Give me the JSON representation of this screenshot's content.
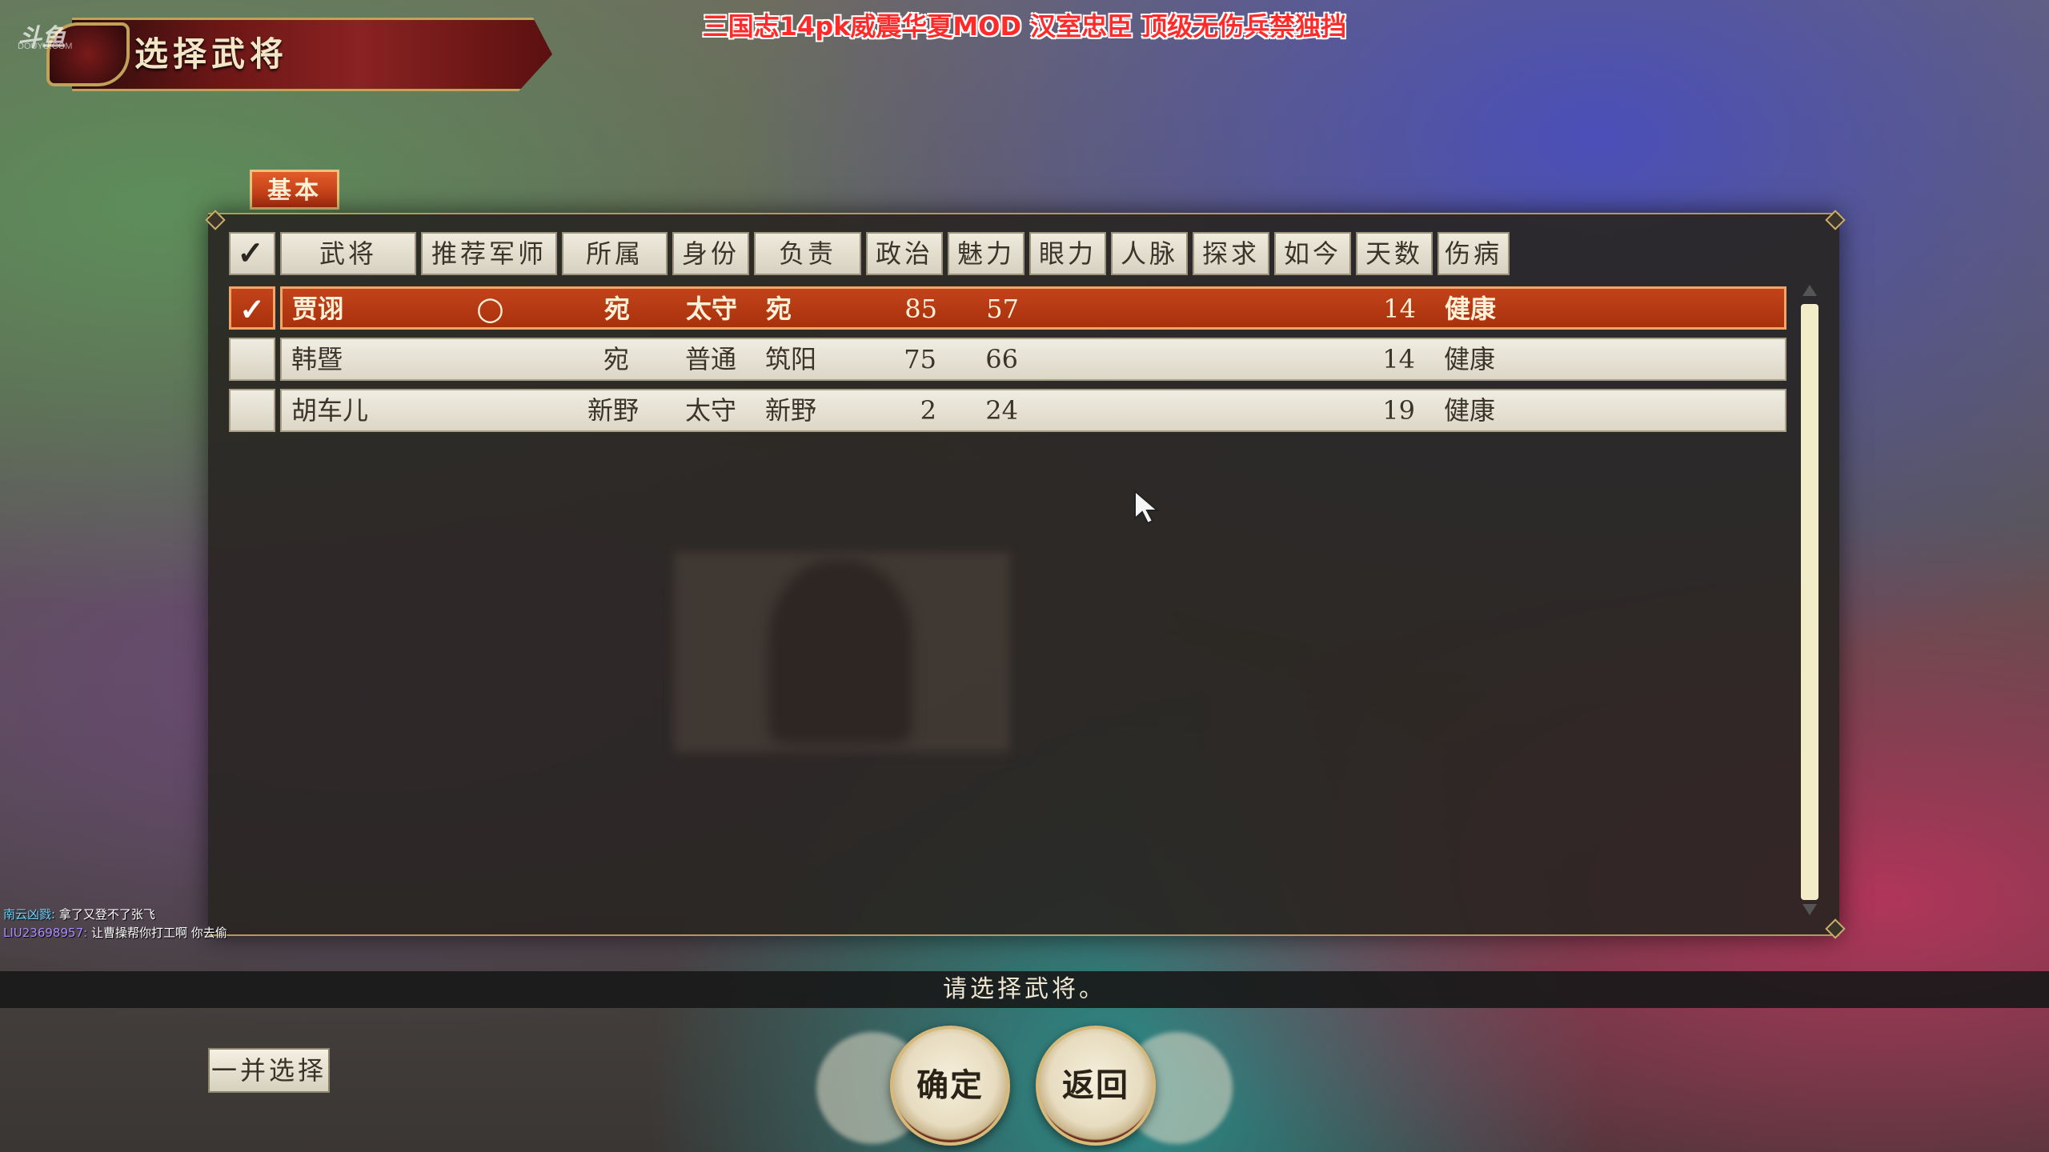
{
  "window": {
    "title": "选择武将",
    "watermark": "斗鱼",
    "watermark_sub": "DOUYU.COM"
  },
  "stream_caption": "三国志14pk威震华夏MOD 汉室忠臣 顶级无伤兵禁独挡",
  "tabs": [
    {
      "label": "基本",
      "active": true
    }
  ],
  "table": {
    "header_check": "✓",
    "columns": [
      "武将",
      "推荐军师",
      "所属",
      "身份",
      "负责",
      "政治",
      "魅力",
      "眼力",
      "人脉",
      "探求",
      "如今",
      "天数",
      "伤病"
    ],
    "rows": [
      {
        "checked": true,
        "check_mark": "✓",
        "name": "贾诩",
        "advisor_mark": "○",
        "affiliation": "宛",
        "rank": "太守",
        "charge": "宛",
        "politics": "85",
        "charisma": "57",
        "days": "14",
        "health": "健康",
        "selected": true
      },
      {
        "checked": false,
        "check_mark": "",
        "name": "韩暨",
        "advisor_mark": "",
        "affiliation": "宛",
        "rank": "普通",
        "charge": "筑阳",
        "politics": "75",
        "charisma": "66",
        "days": "14",
        "health": "健康",
        "selected": false
      },
      {
        "checked": false,
        "check_mark": "",
        "name": "胡车儿",
        "advisor_mark": "",
        "affiliation": "新野",
        "rank": "太守",
        "charge": "新野",
        "politics": "2",
        "charisma": "24",
        "days": "19",
        "health": "健康",
        "selected": false
      }
    ]
  },
  "chat": [
    {
      "user": "南云凶戮:",
      "message": "拿了又登不了张飞"
    },
    {
      "user": "LIU23698957:",
      "message": "让曹操帮你打工啊 你去偷"
    }
  ],
  "status_message": "请选择武将。",
  "buttons": {
    "select_all": "一并选择",
    "confirm": "确定",
    "back": "返回"
  },
  "colors": {
    "selected_row": "#b5360f",
    "accent_gold": "#c2a25b",
    "caption_red": "#ff2a2a"
  }
}
